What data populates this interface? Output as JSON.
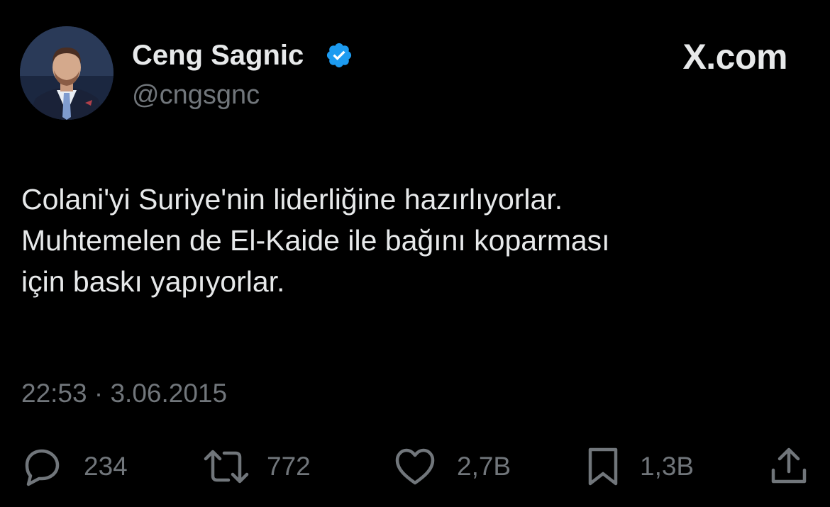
{
  "author": {
    "display_name": "Ceng Sagnic",
    "handle": "@cngsgnc",
    "verified_icon": "verified-badge-icon",
    "verified_color": "#1d9bf0"
  },
  "brand": {
    "label": "X.com"
  },
  "tweet": {
    "lines": [
      "Colani'yi Suriye'nin liderliğine hazırlıyorlar.",
      "Muhtemelen de El-Kaide ile bağını koparması",
      "için baskı yapıyorlar."
    ],
    "meta": "22:53 · 3.06.2015"
  },
  "actions": {
    "reply": {
      "icon": "reply-icon",
      "count": "234"
    },
    "retweet": {
      "icon": "retweet-icon",
      "count": "772"
    },
    "like": {
      "icon": "heart-icon",
      "count": "2,7B"
    },
    "bookmark": {
      "icon": "bookmark-icon",
      "count": "1,3B"
    },
    "share": {
      "icon": "share-icon"
    }
  },
  "colors": {
    "background": "#000000",
    "text_primary": "#e7e9ea",
    "text_secondary": "#71767b"
  }
}
